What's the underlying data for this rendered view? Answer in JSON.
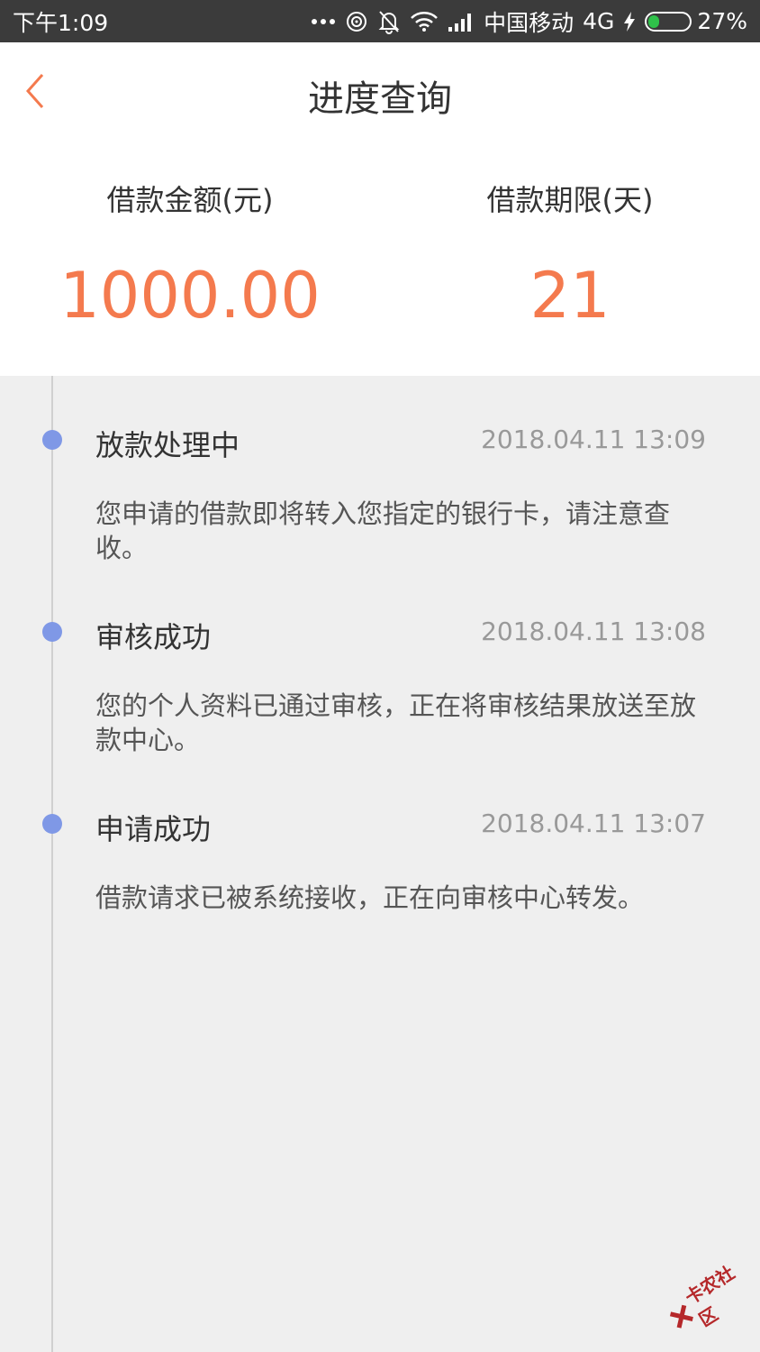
{
  "status_bar": {
    "time": "下午1:09",
    "carrier": "中国移动",
    "network": "4G",
    "battery": "27%",
    "battery_level": 0.27,
    "icons": [
      "more-dots-icon",
      "hotspot-icon",
      "mute-bell-icon",
      "wifi-icon",
      "signal-icon",
      "charging-icon",
      "battery-icon"
    ]
  },
  "header": {
    "title": "进度查询",
    "back_icon": "chevron-left-icon",
    "accent_color": "#f47a4e"
  },
  "summary": {
    "amount_label": "借款金额(元)",
    "amount_value": "1000.00",
    "term_label": "借款期限(天)",
    "term_value": "21"
  },
  "timeline": {
    "dot_color": "#7f98e6",
    "entries": [
      {
        "title": "放款处理中",
        "time": "2018.04.11 13:09",
        "description": "您申请的借款即将转入您指定的银行卡，请注意查收。"
      },
      {
        "title": "审核成功",
        "time": "2018.04.11 13:08",
        "description": "您的个人资料已通过审核，正在将审核结果放送至放款中心。"
      },
      {
        "title": "申请成功",
        "time": "2018.04.11 13:07",
        "description": "借款请求已被系统接收，正在向审核中心转发。"
      }
    ]
  },
  "watermark": {
    "text": "卡农社区"
  }
}
